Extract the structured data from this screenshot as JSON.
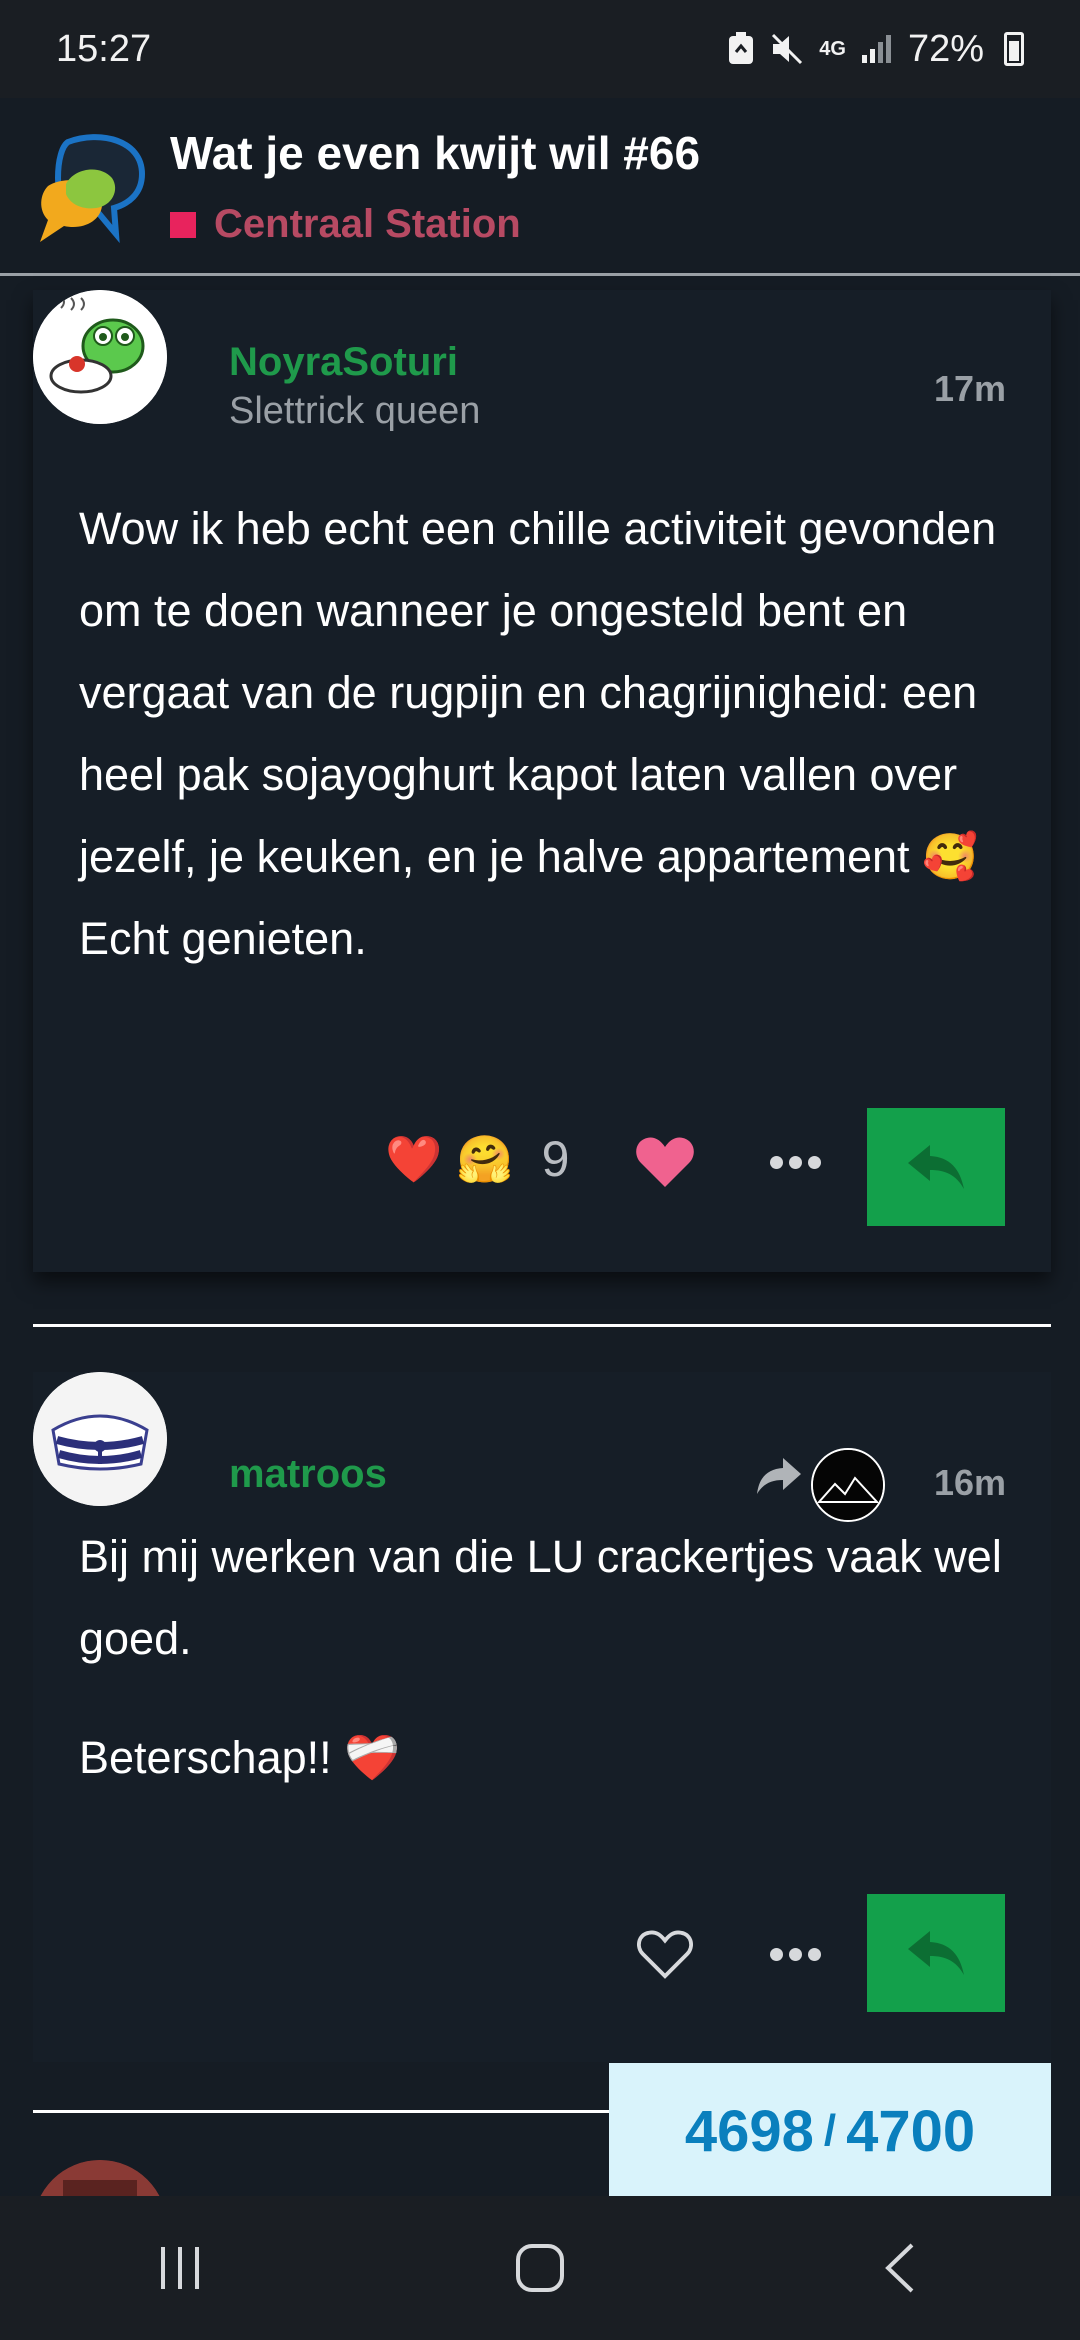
{
  "status_bar": {
    "time": "15:27",
    "network": "4G",
    "battery": "72%"
  },
  "topic": {
    "title": "Wat je even kwijt wil #66",
    "category": "Centraal Station",
    "category_color": "#e8235d"
  },
  "posts": [
    {
      "username": "NoyraSoturi",
      "user_title": "Slettrick queen",
      "time": "17m",
      "body": [
        "Wow ik heb echt een chille activiteit gevonden om te doen wanneer je ongesteld bent en vergaat van de rugpijn en chagrijnigheid: een heel pak sojayoghurt kapot laten vallen over jezelf, je keuken, en je halve appartement 🥰 Echt genieten."
      ],
      "reactions": [
        "❤️",
        "🤗"
      ],
      "reaction_count": "9",
      "liked": true
    },
    {
      "username": "matroos",
      "user_title": "",
      "time": "16m",
      "body": [
        "Bij mij werken van die LU crackertjes vaak wel goed.",
        "Beterschap!! ❤️‍🩹"
      ],
      "liked": false
    }
  ],
  "progress": {
    "current": "4698",
    "separator": "/",
    "total": "4700"
  },
  "colors": {
    "accent_green": "#13a04b",
    "username_green": "#1f9a4b",
    "progress_blue": "#0a7fbd",
    "like_pink": "#f0628f"
  }
}
